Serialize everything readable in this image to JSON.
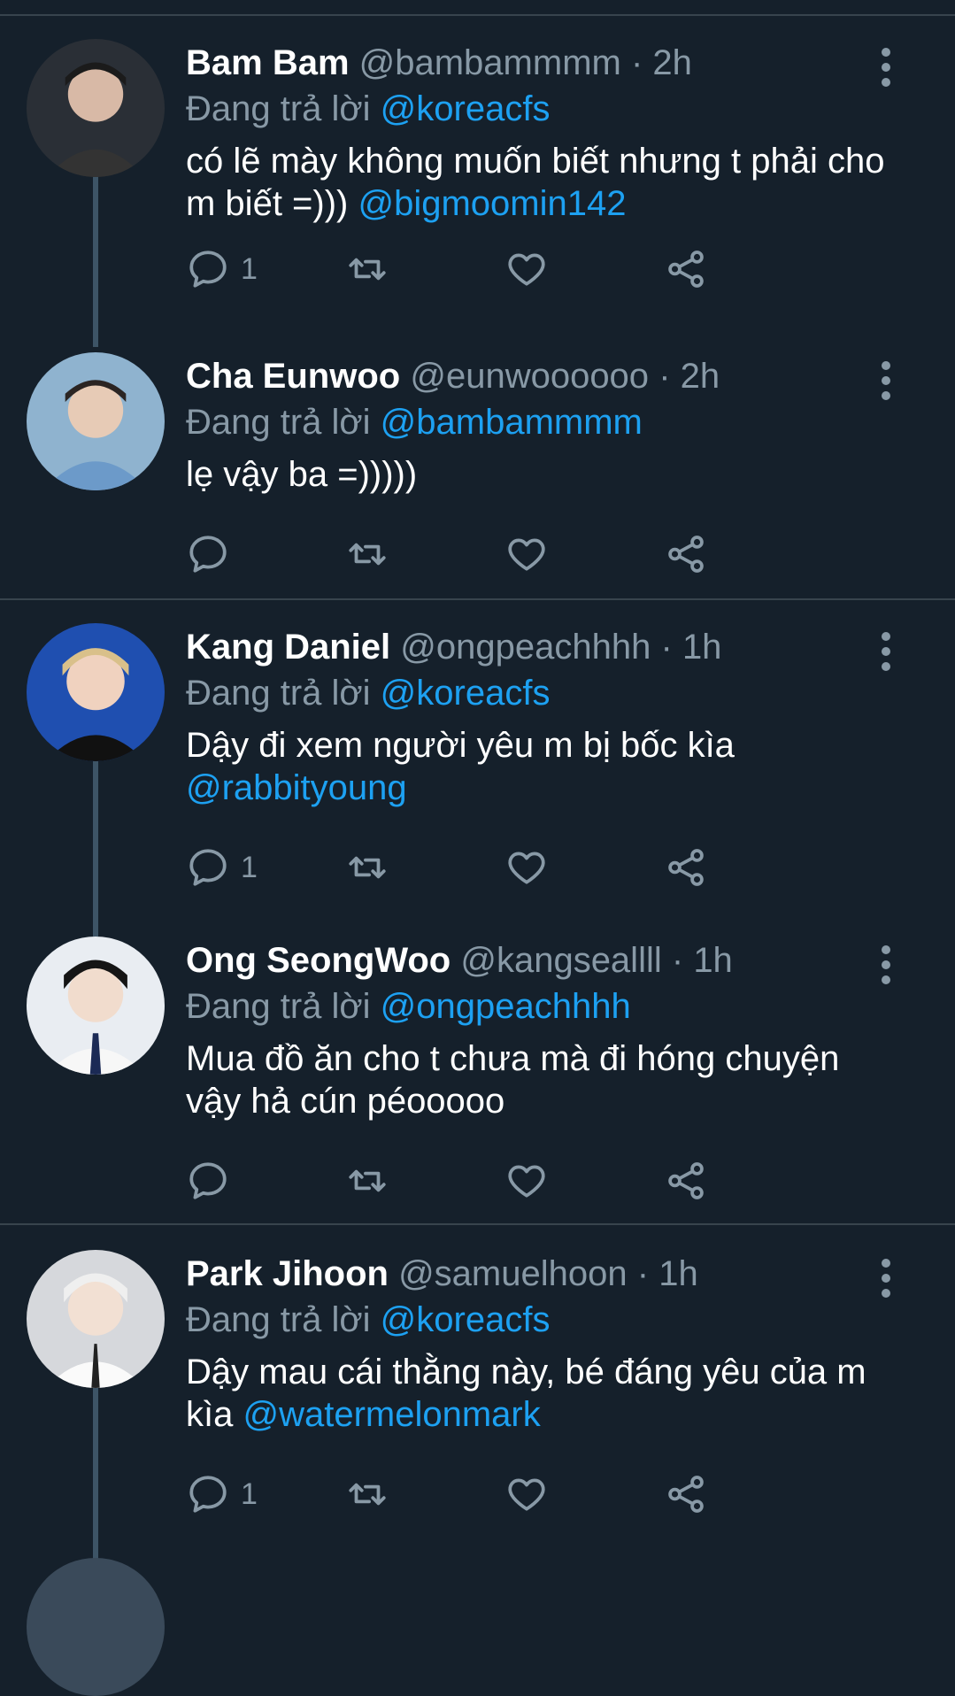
{
  "colors": {
    "background": "#15202b",
    "mention": "#1da1f2",
    "muted": "#8899a6",
    "divider": "#38444d"
  },
  "reply_prefix": "Đang trả lời",
  "tweets": [
    {
      "name": "Bam Bam",
      "handle": "@bambammmm",
      "sep": "·",
      "time": "2h",
      "reply_to": "@koreacfs",
      "text": "có lẽ mày không muốn biết nhưng t phải cho m biết =)))",
      "text_mention": "@bigmoomin142",
      "reply_count": "1"
    },
    {
      "name": "Cha Eunwoo",
      "handle": "@eunwoooooo",
      "sep": "·",
      "time": "2h",
      "reply_to": "@bambammmm",
      "text": "lẹ vậy ba =)))))",
      "text_mention": "",
      "reply_count": ""
    },
    {
      "name": "Kang Daniel",
      "handle": "@ongpeachhhh",
      "sep": "·",
      "time": "1h",
      "reply_to": "@koreacfs",
      "text": "Dậy đi xem người yêu m bị bốc kìa",
      "text_mention": "@rabbityoung",
      "reply_count": "1"
    },
    {
      "name": "Ong SeongWoo",
      "handle": "@kangseallll",
      "sep": "·",
      "time": "1h",
      "reply_to": "@ongpeachhhh",
      "text": "Mua đồ ăn cho t chưa mà đi hóng chuyện vậy hả cún péooooo",
      "text_mention": "",
      "reply_count": ""
    },
    {
      "name": "Park Jihoon",
      "handle": "@samuelhoon",
      "sep": "·",
      "time": "1h",
      "reply_to": "@koreacfs",
      "text": "Dậy mau cái thằng này, bé đáng yêu của m kìa",
      "text_mention": "@watermelonmark",
      "reply_count": "1"
    }
  ],
  "icons": {
    "reply": "reply-icon",
    "retweet": "retweet-icon",
    "like": "heart-icon",
    "share": "share-icon",
    "more": "more-vertical-icon"
  }
}
